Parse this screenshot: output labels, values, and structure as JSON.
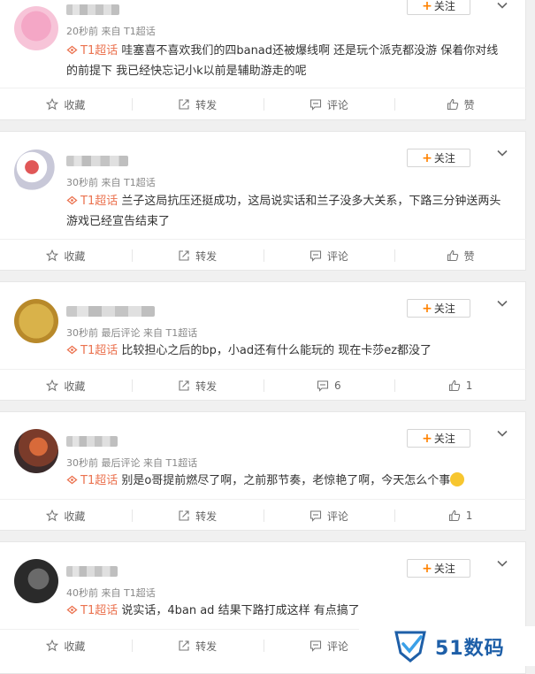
{
  "posts": [
    {
      "meta": "20秒前 来自 T1超话",
      "topic": "T1超话",
      "text": " 哇塞喜不喜欢我们的四banad还被爆线啊 还是玩个派克都没游 保着你对线的前提下 我已经快忘记小k以前是辅助游走的呢",
      "follow_label": "关注",
      "actions": {
        "collect": "收藏",
        "repost": "转发",
        "comment": "评论",
        "like": "赞"
      }
    },
    {
      "meta": "30秒前 来自 T1超话",
      "topic": "T1超话",
      "text": " 兰子这局抗压还挺成功，这局说实话和兰子没多大关系，下路三分钟送两头游戏已经宣告结束了",
      "follow_label": "关注",
      "actions": {
        "collect": "收藏",
        "repost": "转发",
        "comment": "评论",
        "like": "赞"
      }
    },
    {
      "meta": "30秒前 最后评论 来自 T1超话",
      "topic": "T1超话",
      "text": " 比较担心之后的bp，小ad还有什么能玩的 现在卡莎ez都没了",
      "follow_label": "关注",
      "actions": {
        "collect": "收藏",
        "repost": "转发",
        "comment": "6",
        "like": "1"
      }
    },
    {
      "meta": "30秒前 最后评论 来自 T1超话",
      "topic": "T1超话",
      "text": " 别是o哥提前燃尽了啊，之前那节奏，老惊艳了啊，今天怎么个事",
      "follow_label": "关注",
      "actions": {
        "collect": "收藏",
        "repost": "转发",
        "comment": "评论",
        "like": "1"
      }
    },
    {
      "meta": "40秒前 来自 T1超话",
      "topic": "T1超话",
      "text": " 说实话，4ban ad 结果下路打成这样 有点搞了",
      "follow_label": "关注",
      "actions": {
        "collect": "收藏",
        "repost": "转发",
        "comment": "评论",
        "like": "赞"
      }
    }
  ],
  "watermark": {
    "text": "51数码"
  },
  "colors": {
    "accent": "#ff8200",
    "topic": "#eb7350",
    "brand": "#1e5fa8"
  }
}
